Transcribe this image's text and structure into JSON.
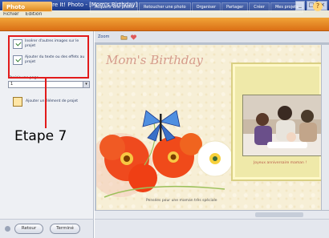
{
  "window": {
    "title": "Microsoft Picture It! Photo - [Mom's Birthday]",
    "menu": [
      "Fichier",
      "Edition"
    ],
    "controls": [
      "_",
      "□",
      "×"
    ]
  },
  "toolbar": {
    "brand": "Photo",
    "tabs": [
      "Acquérir une photo",
      "Retoucher une photo",
      "Organiser",
      "Partager",
      "Créer",
      "Mes projets"
    ],
    "help": "?"
  },
  "left_panel": {
    "tasks": [
      {
        "label": "Insérer d'autres images sur le projet"
      },
      {
        "label": "Ajouter du texte ou des effets au projet"
      }
    ],
    "select_label": "Choisir une page",
    "select_value": "1",
    "add_item": "Ajouter un élément de projet",
    "nav": {
      "back": "Retour",
      "next": "Terminé"
    }
  },
  "annotation": {
    "step_label": "Etape 7"
  },
  "canvas": {
    "mini_toolbar": {
      "label": "Zoom"
    },
    "card_title": "Mom's Birthday",
    "photo_caption": "Joyeux anniversaire maman !",
    "flower_caption": "Pensées pour une maman très spéciale"
  },
  "colors": {
    "toolbar_orange": "#e8861f",
    "annotation_red": "#e21b1b",
    "card_background": "#f7efd6"
  }
}
